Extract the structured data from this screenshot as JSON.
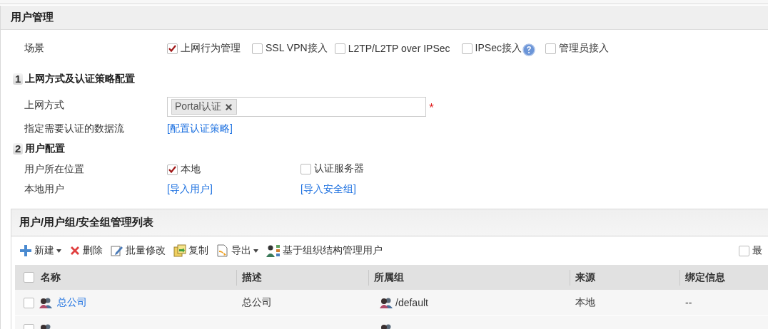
{
  "title": "用户管理",
  "scene": {
    "label": "场景",
    "options": [
      {
        "label": "上网行为管理",
        "checked": true
      },
      {
        "label": "SSL VPN接入",
        "checked": false
      },
      {
        "label": "L2TP/L2TP over IPSec",
        "checked": false
      },
      {
        "label": "IPSec接入",
        "checked": false,
        "help": true
      },
      {
        "label": "管理员接入",
        "checked": false
      }
    ]
  },
  "section_1": {
    "number": "1",
    "title": "上网方式及认证策略配置",
    "access_method": {
      "label": "上网方式",
      "tags": [
        "Portal认证"
      ],
      "required": true
    },
    "auth_flow": {
      "label": "指定需要认证的数据流",
      "link": "[配置认证策略]"
    }
  },
  "section_2": {
    "number": "2",
    "title": "用户配置",
    "location": {
      "label": "用户所在位置",
      "options": [
        {
          "label": "本地",
          "checked": true
        },
        {
          "label": "认证服务器",
          "checked": false
        }
      ]
    },
    "local_users": {
      "label": "本地用户",
      "links": [
        "[导入用户]",
        "[导入安全组]"
      ]
    }
  },
  "list_panel": {
    "title": "用户/用户组/安全组管理列表",
    "toolbar": [
      {
        "kind": "plus",
        "label": "新建",
        "dropdown": true
      },
      {
        "kind": "delete",
        "label": "删除",
        "dropdown": false
      },
      {
        "kind": "edit",
        "label": "批量修改",
        "dropdown": false
      },
      {
        "kind": "copy",
        "label": "复制",
        "dropdown": false
      },
      {
        "kind": "export",
        "label": "导出",
        "dropdown": true
      },
      {
        "kind": "org",
        "label": "基于组织结构管理用户",
        "dropdown": false
      }
    ],
    "maximize": {
      "label": "最",
      "checked": false
    },
    "table": {
      "select_all": false,
      "columns": [
        "名称",
        "描述",
        "所属组",
        "来源",
        "绑定信息"
      ],
      "rows": [
        {
          "selected": false,
          "name": "总公司",
          "description": "总公司",
          "group": "/default",
          "source": "本地",
          "binding": "--"
        },
        {
          "selected": false
        }
      ]
    }
  }
}
